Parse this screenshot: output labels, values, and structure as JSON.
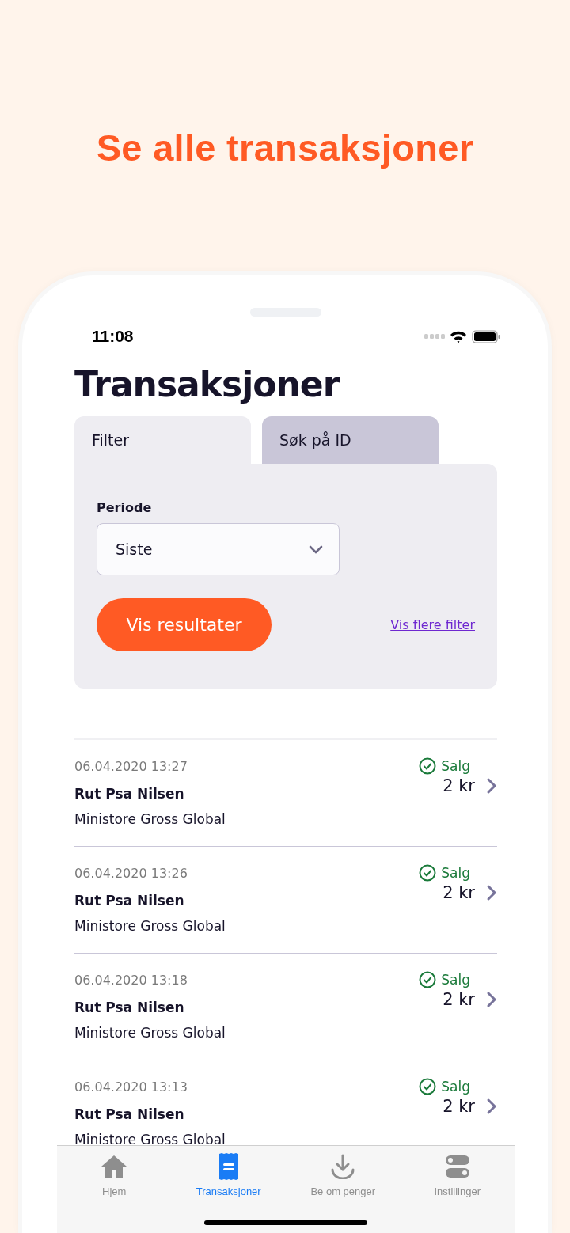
{
  "headline": "Se alle transaksjoner",
  "status_bar": {
    "time": "11:08"
  },
  "title": "Transaksjoner",
  "tabs": [
    {
      "label": "Filter",
      "selected": true
    },
    {
      "label": "Søk på ID",
      "selected": false
    }
  ],
  "filter": {
    "label": "Periode",
    "value": "Siste",
    "button": "Vis resultater",
    "link": "Vis flere filter"
  },
  "transactions": [
    {
      "time": "06.04.2020 13:27",
      "name": "Rut Psa Nilsen",
      "merchant": "Ministore Gross Global",
      "status": "Salg",
      "amount": "2 kr"
    },
    {
      "time": "06.04.2020 13:26",
      "name": "Rut Psa Nilsen",
      "merchant": "Ministore Gross Global",
      "status": "Salg",
      "amount": "2 kr"
    },
    {
      "time": "06.04.2020 13:18",
      "name": "Rut Psa Nilsen",
      "merchant": "Ministore Gross Global",
      "status": "Salg",
      "amount": "2 kr"
    },
    {
      "time": "06.04.2020 13:13",
      "name": "Rut Psa Nilsen",
      "merchant": "Ministore Gross Global",
      "status": "Salg",
      "amount": "2 kr"
    }
  ],
  "tab_bar": [
    {
      "kind": "home",
      "label": "Hjem",
      "selected": false
    },
    {
      "kind": "receipt",
      "label": "Transaksjoner",
      "selected": true
    },
    {
      "kind": "download",
      "label": "Be om penger",
      "selected": false
    },
    {
      "kind": "toggles",
      "label": "Instillinger",
      "selected": false
    }
  ]
}
